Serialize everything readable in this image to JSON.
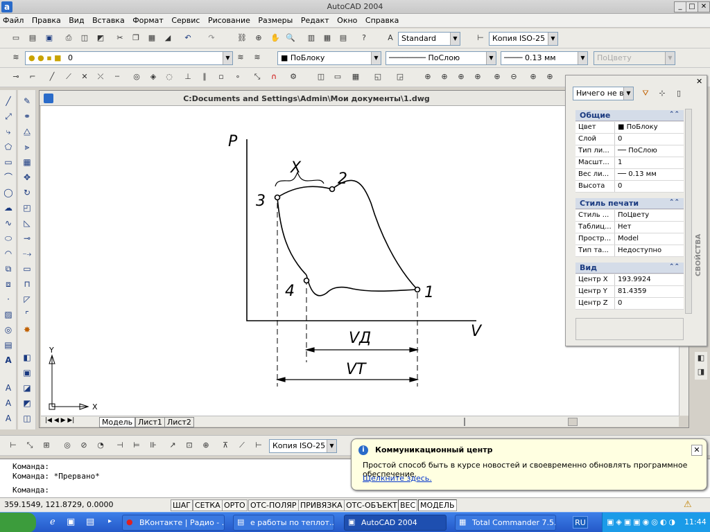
{
  "window": {
    "title": "AutoCAD 2004",
    "app_icon": "a"
  },
  "menu": [
    "Файл",
    "Правка",
    "Вид",
    "Вставка",
    "Формат",
    "Сервис",
    "Рисование",
    "Размеры",
    "Редакт",
    "Окно",
    "Справка"
  ],
  "toolbar": {
    "textstyle": "Standard",
    "dimstyle": "Копия ISO-25",
    "layer": "0",
    "color": "ПоБлоку",
    "linetype": "ПоСлою",
    "lineweight": "0.13 мм",
    "plotstyle": "ПоЦвету"
  },
  "drawing": {
    "filename": "C:Documents and Settings\\Admin\\Мои документы\\1.dwg",
    "labels": {
      "p": "P",
      "v": "V",
      "x": "X",
      "vd": "VД",
      "vt": "VТ",
      "p1": "1",
      "p2": "2",
      "p3": "3",
      "p4": "4"
    },
    "ucs": {
      "x": "X",
      "y": "Y"
    },
    "tabs": [
      "Модель",
      "Лист1",
      "Лист2"
    ]
  },
  "properties": {
    "selection": "Ничего не вы",
    "side_title": "СВОЙСТВА",
    "sections": [
      {
        "title": "Общие",
        "rows": [
          {
            "key": "Цвет",
            "value": "ПоБлоку"
          },
          {
            "key": "Слой",
            "value": "0"
          },
          {
            "key": "Тип ли...",
            "value": "ПоСлою"
          },
          {
            "key": "Масшт...",
            "value": "1"
          },
          {
            "key": "Вес ли...",
            "value": "0.13 мм"
          },
          {
            "key": "Высота",
            "value": "0"
          }
        ]
      },
      {
        "title": "Стиль печати",
        "rows": [
          {
            "key": "Стиль ...",
            "value": "ПоЦвету"
          },
          {
            "key": "Таблиц...",
            "value": "Нет"
          },
          {
            "key": "Простр...",
            "value": "Model"
          },
          {
            "key": "Тип та...",
            "value": "Недоступно"
          }
        ]
      },
      {
        "title": "Вид",
        "rows": [
          {
            "key": "Центр X",
            "value": "193.9924"
          },
          {
            "key": "Центр Y",
            "value": "81.4359"
          },
          {
            "key": "Центр Z",
            "value": "0"
          }
        ]
      }
    ]
  },
  "dimtoolbar": {
    "dimstyle": "Копия ISO-25"
  },
  "command": {
    "line1": "Команда:",
    "line2": "Команда: *Прервано*",
    "line3": "Команда:"
  },
  "status": {
    "coords": "359.1549, 121.8729, 0.0000",
    "buttons": [
      "ШАГ",
      "СЕТКА",
      "ОРТО",
      "ОТС-ПОЛЯР",
      "ПРИВЯЗКА",
      "ОТС-ОБЪЕКТ",
      "ВЕС",
      "МОДЕЛЬ"
    ]
  },
  "balloon": {
    "title": "Коммуникационный центр",
    "text": "Простой способ быть в курсе новостей и своевременно обновлять программное обеспечение.",
    "link": "Щелкните здесь."
  },
  "taskbar": {
    "tasks": [
      "ВКонтакте | Радио - ...",
      "е работы по теплот...",
      "AutoCAD 2004",
      "Total Commander 7.5..."
    ],
    "lang": "RU",
    "time": "11:44"
  }
}
